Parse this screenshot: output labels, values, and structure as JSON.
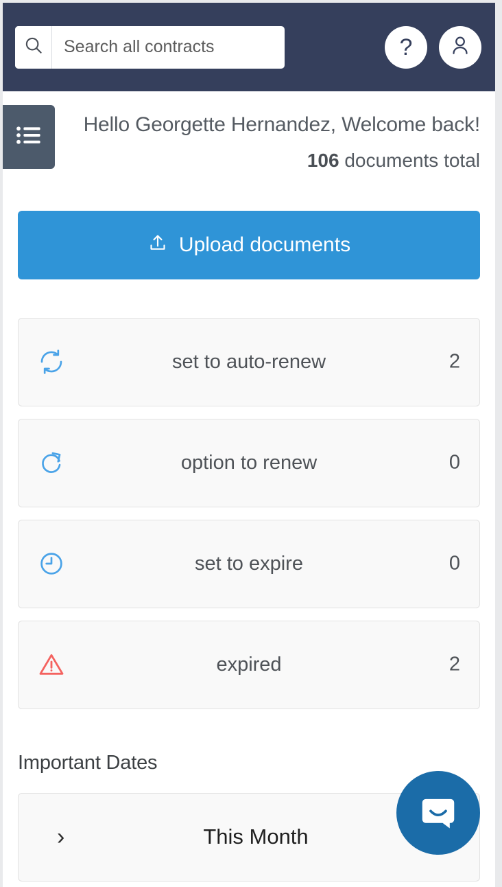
{
  "topbar": {
    "search": {
      "placeholder": "Search all contracts",
      "value": "",
      "icon": "search-icon",
      "button_label": ""
    },
    "help_label": "?",
    "account_icon": "user-icon",
    "background_color": "#353f5c"
  },
  "menu": {
    "icon": "list-menu-icon",
    "background_color": "#4c5a6b"
  },
  "greeting": {
    "hello": "Hello Georgette Hernandez, Welcome back!",
    "documents_count": "106",
    "documents_suffix": " documents total"
  },
  "upload": {
    "label": "Upload documents",
    "icon": "upload-icon",
    "color": "#2f94d7"
  },
  "statuses": [
    {
      "label": "set to auto-renew",
      "count": "2",
      "icon": "auto-renew-icon",
      "color": "#4aa3e8"
    },
    {
      "label": "option to renew",
      "count": "0",
      "icon": "renew-icon",
      "color": "#4aa3e8"
    },
    {
      "label": "set to expire",
      "count": "0",
      "icon": "clock-icon",
      "color": "#4aa3e8"
    },
    {
      "label": "expired",
      "count": "2",
      "icon": "warning-triangle-icon",
      "color": "#f4625f"
    }
  ],
  "important_dates": {
    "title": "Important Dates",
    "rows": [
      {
        "chevron": "›",
        "label": "This Month",
        "count": ")"
      }
    ]
  },
  "chat": {
    "icon": "chat-bubble-icon",
    "color": "#1b6ca8"
  }
}
